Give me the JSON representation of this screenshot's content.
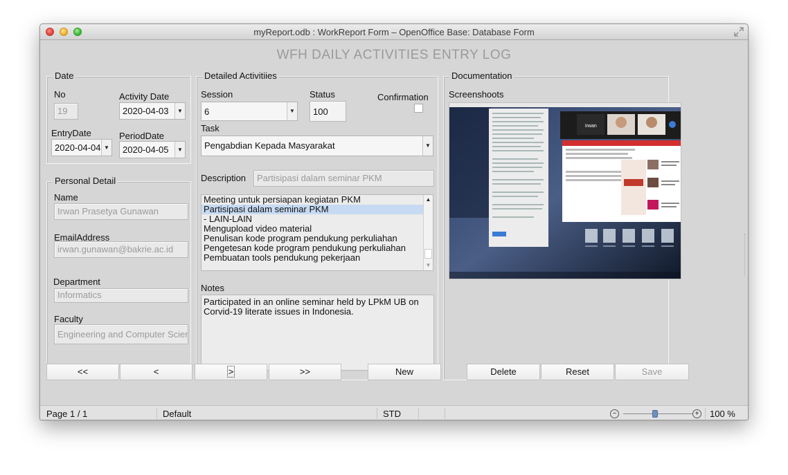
{
  "window": {
    "title": "myReport.odb : WorkReport Form – OpenOffice Base: Database Form"
  },
  "form": {
    "title": "WFH DAILY ACTIVITIES ENTRY LOG"
  },
  "date": {
    "group_label": "Date",
    "no_label": "No",
    "no_value": "19",
    "activity_date_label": "Activity Date",
    "activity_date_value": "2020-04-03",
    "entry_date_label": "EntryDate",
    "entry_date_value": "2020-04-04",
    "period_date_label": "PeriodDate",
    "period_date_value": "2020-04-05"
  },
  "personal": {
    "group_label": "Personal Detail",
    "name_label": "Name",
    "name_value": "Irwan Prasetya Gunawan",
    "email_label": "EmailAddress",
    "email_value": "irwan.gunawan@bakrie.ac.id",
    "department_label": "Department",
    "department_value": "Informatics",
    "faculty_label": "Faculty",
    "faculty_value": "Engineering and Computer Scier"
  },
  "detailed": {
    "group_label": "Detailed Activitiies",
    "session_label": "Session",
    "session_value": "6",
    "status_label": "Status",
    "status_value": "100",
    "confirmation_label": "Confirmation",
    "confirmation_checked": false,
    "task_label": "Task",
    "task_value": "Pengabdian Kepada Masyarakat",
    "description_label": "Description",
    "description_value": "Partisipasi dalam seminar PKM",
    "list_items": [
      "Meeting untuk persiapan kegiatan PKM",
      "Partisipasi dalam seminar PKM",
      "- LAIN-LAIN",
      "Mengupload video material",
      "Penulisan kode program pendukung perkuliahan",
      "Pengetesan kode program pendukung perkuliahan",
      "Pembuatan tools pendukung pekerjaan"
    ],
    "list_selected_index": 1,
    "notes_label": "Notes",
    "notes_value": "Participated in an online seminar held by LPkM UB on Corvid-19 literate issues in Indonesia."
  },
  "documentation": {
    "group_label": "Documentation",
    "screenshots_label": "Screenshoots",
    "shot_caption": "irwan"
  },
  "nav": {
    "first": "<<",
    "prev": "<",
    "next": ">",
    "last": ">>",
    "new": "New",
    "delete": "Delete",
    "reset": "Reset",
    "save": "Save"
  },
  "status": {
    "page": "Page 1 / 1",
    "style": "Default",
    "mode": "STD",
    "zoom": "100 %"
  },
  "icons": [
    "close-icon",
    "minimize-icon",
    "maximize-icon",
    "fullscreen-icon",
    "dropdown-arrow-icon",
    "scroll-up-icon",
    "scroll-down-icon",
    "zoom-out-icon",
    "zoom-in-icon"
  ]
}
